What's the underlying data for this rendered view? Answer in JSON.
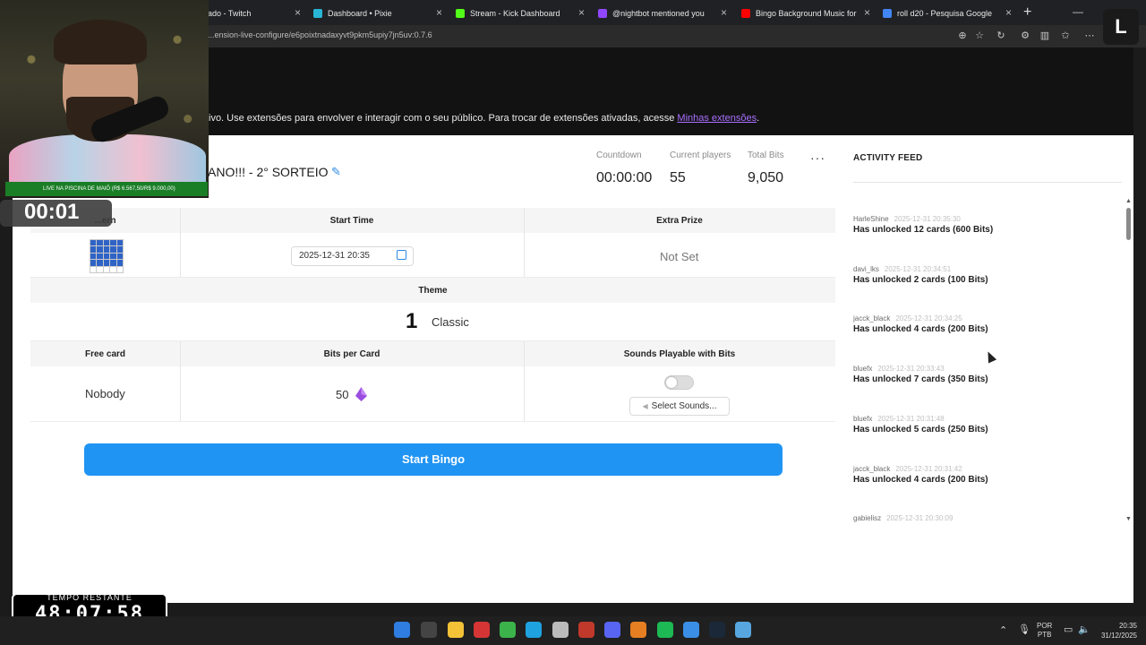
{
  "browser": {
    "tabs": [
      {
        "title": "",
        "color": "#9146ff"
      },
      {
        "title": "...entado - Twitch",
        "color": "#9146ff"
      },
      {
        "title": "Dashboard • Pixie",
        "color": "#29b6d6"
      },
      {
        "title": "Stream - Kick Dashboard",
        "color": "#53fc18"
      },
      {
        "title": "@nightbot mentioned you",
        "color": "#9146ff"
      },
      {
        "title": "Bingo Background Music for",
        "color": "#ff0000"
      },
      {
        "title": "roll d20 - Pesquisa Google",
        "color": "#4285f4"
      }
    ],
    "url": "...ension-live-configure/e6poixtnadaxyvt9pkm5upiy7jn5uv:0.7.6"
  },
  "banner": {
    "text": "ivo. Use extensões para envolver e interagir com o seu público. Para trocar de extensões ativadas, acesse ",
    "link": "Minhas extensões",
    "suffix": "."
  },
  "game": {
    "title": "ANO!!! - 2° SORTEIO",
    "stats": [
      {
        "label": "Countdown",
        "value": "00:00:00"
      },
      {
        "label": "Current players",
        "value": "55"
      },
      {
        "label": "Total Bits",
        "value": "9,050"
      }
    ],
    "more": "···"
  },
  "table": {
    "row1_headers": [
      "...ern",
      "Start Time",
      "Extra Prize"
    ],
    "start_time": "2025-12-31 20:35",
    "extra_prize": "Not Set",
    "theme_header": "Theme",
    "theme_number": "1",
    "theme_name": "Classic",
    "row3_headers": [
      "Free card",
      "Bits per Card",
      "Sounds Playable with Bits"
    ],
    "free_card": "Nobody",
    "bits_per_card": "50",
    "sounds_button": "Select Sounds...",
    "sounds_enabled": false
  },
  "start_button": "Start Bingo",
  "feed": {
    "title": "ACTIVITY FEED",
    "items": [
      {
        "user": "HarleShine",
        "time": "2025-12-31 20:35:30",
        "msg": "Has unlocked 12 cards (600 Bits)"
      },
      {
        "user": "davi_lks",
        "time": "2025-12-31 20:34:51",
        "msg": "Has unlocked 2 cards (100 Bits)"
      },
      {
        "user": "jacck_black",
        "time": "2025-12-31 20:34:25",
        "msg": "Has unlocked 4 cards (200 Bits)"
      },
      {
        "user": "bluefx",
        "time": "2025-12-31 20:33:43",
        "msg": "Has unlocked 7 cards (350 Bits)"
      },
      {
        "user": "bluefx",
        "time": "2025-12-31 20:31:48",
        "msg": "Has unlocked 5 cards (250 Bits)"
      },
      {
        "user": "jacck_black",
        "time": "2025-12-31 20:31:42",
        "msg": "Has unlocked 4 cards (200 Bits)"
      },
      {
        "user": "gabielisz",
        "time": "2025-12-31 20:30:09",
        "msg": ""
      }
    ]
  },
  "overlay": {
    "cam_caption": "LIVE NA PISCINA DE MAIÔ (R$ 6.567,50/R$ 9.000,00)",
    "timer_small": "00:01",
    "timer_label": "TEMPO RESTANTE",
    "timer_value": "48:07:58",
    "logo": "L"
  },
  "taskbar": {
    "lang_1": "POR",
    "lang_2": "PTB",
    "time": "20:35",
    "date": "31/12/2025"
  }
}
